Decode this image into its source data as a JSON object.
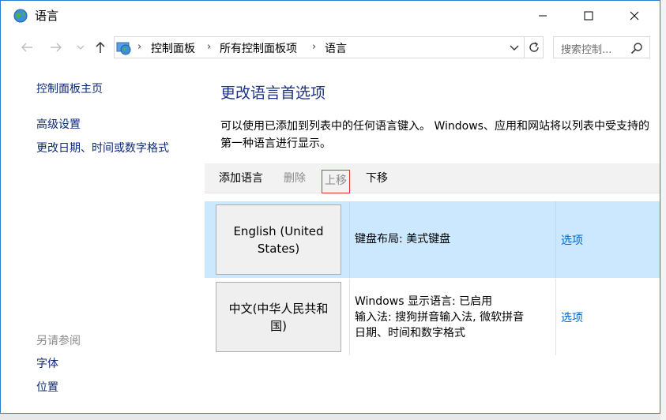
{
  "window": {
    "title": "语言"
  },
  "address": {
    "crumbs": [
      "控制面板",
      "所有控制面板项",
      "语言"
    ],
    "separator": "›"
  },
  "search": {
    "placeholder": "搜索控制..."
  },
  "left": {
    "links": [
      "控制面板主页",
      "高级设置",
      "更改日期、时间或数字格式"
    ],
    "see_also_label": "另请参阅",
    "see_also_links": [
      "字体",
      "位置"
    ]
  },
  "main": {
    "title": "更改语言首选项",
    "description": "可以使用已添加到列表中的任何语言键入。 Windows、应用和网站将以列表中受支持的第一种语言进行显示。",
    "toolbar": {
      "add": "添加语言",
      "remove": "删除",
      "move_up": "上移",
      "move_down": "下移"
    },
    "languages": [
      {
        "name": "English (United States)",
        "info": [
          "键盘布局: 美式键盘"
        ],
        "options": "选项"
      },
      {
        "name": "中文(中华人民共和国)",
        "info": [
          "Windows 显示语言: 已启用",
          "输入法: 搜狗拼音输入法, 微软拼音",
          "日期、时间和数字格式"
        ],
        "options": "选项"
      }
    ]
  },
  "colors": {
    "accent_link": "#0066cc",
    "title_blue": "#1e3287",
    "selected_row": "#cce8ff",
    "highlight_box": "#dd3333"
  }
}
